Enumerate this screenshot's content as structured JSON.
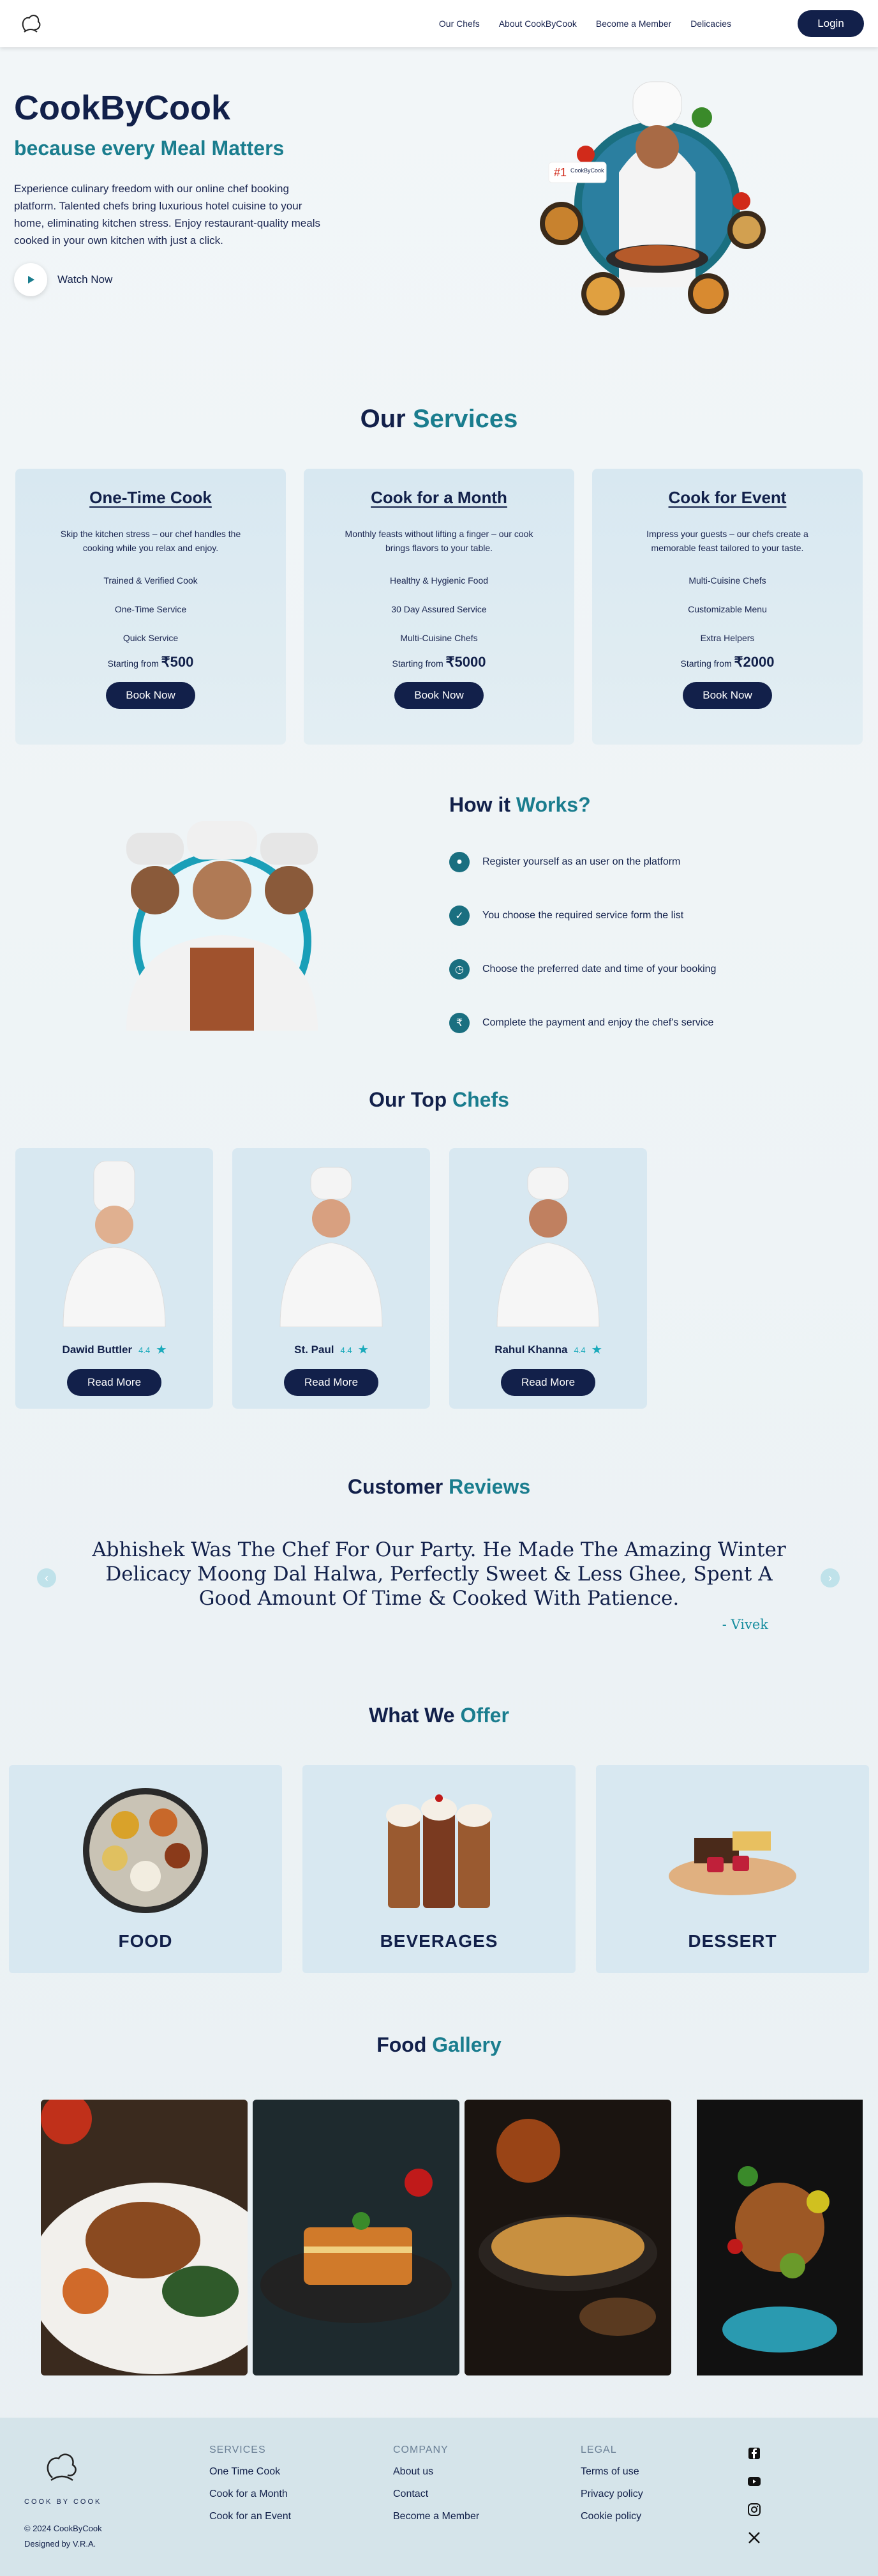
{
  "header": {
    "logo_icon": "chef-hat-logo-icon",
    "nav": [
      "Our Chefs",
      "About CookByCook",
      "Become a Member",
      "Delicacies"
    ],
    "login_label": "Login"
  },
  "hero": {
    "title": "CookByCook",
    "subtitle": "because every Meal Matters",
    "text": "Experience culinary freedom with our online chef booking platform. Talented chefs bring luxurious hotel cuisine to your home, eliminating kitchen stress. Enjoy restaurant-quality meals cooked in your own kitchen with just a click.",
    "watch_label": "Watch Now",
    "badge_rank": "#1",
    "badge_brand": "CookByCook"
  },
  "services": {
    "title_main": "Our",
    "title_accent": "Services",
    "cards": [
      {
        "title": "One-Time Cook",
        "desc": "Skip the kitchen stress – our chef handles the cooking while you relax and enjoy.",
        "features": [
          "Trained & Verified Cook",
          "One-Time Service",
          "Quick Service"
        ],
        "price_label": "Starting from",
        "price": "₹500",
        "button": "Book Now"
      },
      {
        "title": "Cook for a Month",
        "desc": "Monthly feasts without lifting a finger – our cook brings flavors to your table.",
        "features": [
          "Healthy & Hygienic Food",
          "30 Day Assured Service",
          "Multi-Cuisine Chefs"
        ],
        "price_label": "Starting from",
        "price": "₹5000",
        "button": "Book Now"
      },
      {
        "title": "Cook for Event",
        "desc": "Impress your guests – our chefs create a memorable feast tailored to your taste.",
        "features": [
          "Multi-Cuisine Chefs",
          "Customizable Menu",
          "Extra Helpers"
        ],
        "price_label": "Starting from",
        "price": "₹2000",
        "button": "Book Now"
      }
    ]
  },
  "how": {
    "title_main": "How it",
    "title_accent": "Works?",
    "steps": [
      {
        "icon": "user-register-icon",
        "text": "Register yourself as an user on the platform"
      },
      {
        "icon": "checklist-icon",
        "text": "You choose the required service form the list"
      },
      {
        "icon": "clock-icon",
        "text": "Choose the preferred date and time of your booking"
      },
      {
        "icon": "rupee-icon",
        "text": "Complete the payment and enjoy the chef's service"
      }
    ]
  },
  "chefs": {
    "title_main": "Our Top",
    "title_accent": "Chefs",
    "items": [
      {
        "name": "Dawid Buttler",
        "rating": "4.4",
        "button": "Read More"
      },
      {
        "name": "St. Paul",
        "rating": "4.4",
        "button": "Read More"
      },
      {
        "name": "Rahul Khanna",
        "rating": "4.4",
        "button": "Read More"
      }
    ]
  },
  "reviews": {
    "title_main": "Customer",
    "title_accent": "Reviews",
    "text": "Abhishek Was The Chef For Our Party. He Made The Amazing Winter Delicacy Moong Dal Halwa, Perfectly Sweet & Less Ghee, Spent A Good Amount Of Time & Cooked With Patience.",
    "author": "- Vivek"
  },
  "offer": {
    "title_main": "What We",
    "title_accent": "Offer",
    "items": [
      "FOOD",
      "BEVERAGES",
      "DESSERT"
    ]
  },
  "gallery": {
    "title_main": "Food",
    "title_accent": "Gallery"
  },
  "footer": {
    "brand": "COOK BY COOK",
    "copyright": "© 2024 CookByCook",
    "designed": "Designed by V.R.A.",
    "services_heading": "SERVICES",
    "services": [
      "One Time Cook",
      "Cook for a Month",
      "Cook for an Event"
    ],
    "company_heading": "COMPANY",
    "company": [
      "About us",
      "Contact",
      "Become a Member"
    ],
    "legal_heading": "LEGAL",
    "legal": [
      "Terms of use",
      "Privacy policy",
      "Cookie policy"
    ],
    "social": [
      "facebook-icon",
      "youtube-icon",
      "instagram-icon",
      "x-icon"
    ]
  }
}
